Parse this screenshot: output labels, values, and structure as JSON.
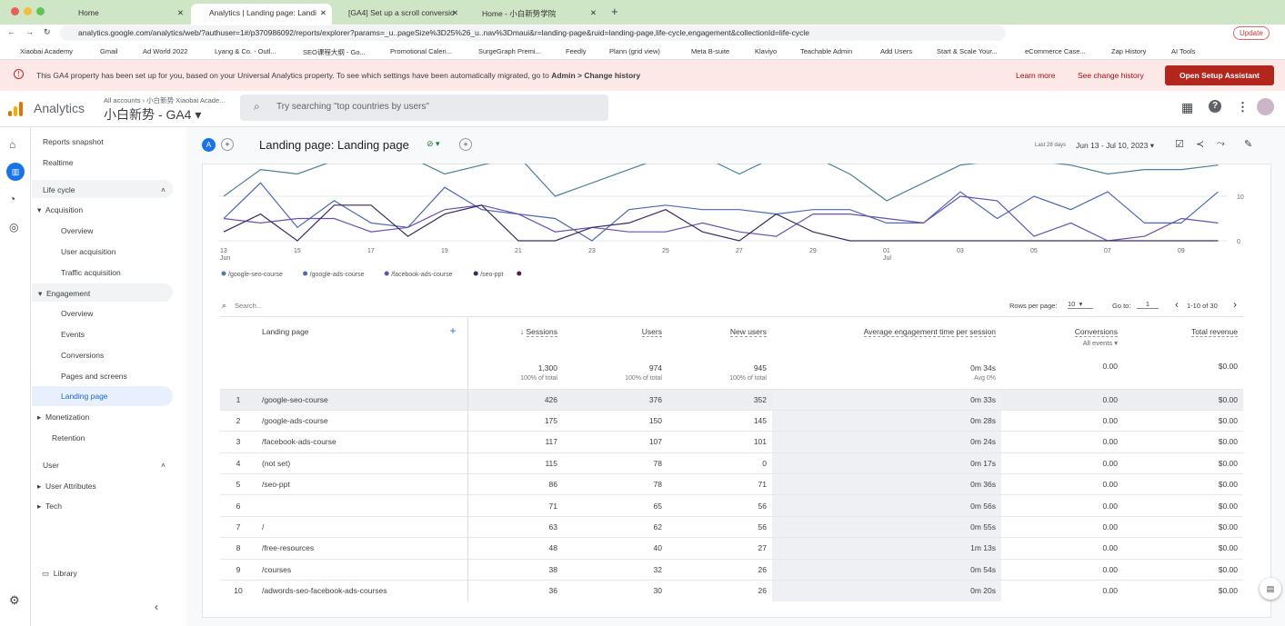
{
  "browser": {
    "tabs": [
      {
        "label": "Home"
      },
      {
        "label": "Analytics | Landing page: Landi"
      },
      {
        "label": "[GA4] Set up a scroll conversio"
      },
      {
        "label": "Home - 小白新势学院"
      }
    ],
    "url": "analytics.google.com/analytics/web/?authuser=1#/p370986092/reports/explorer?params=_u..pageSize%3D25%26_u..nav%3Dmaui&r=landing-page&ruid=landing-page,life-cycle,engagement&collectionId=life-cycle",
    "update_label": "Update",
    "bookmarks": [
      "Xiaobai Academy",
      "Gmail",
      "Ad World 2022",
      "Lyang & Co. - Outl...",
      "SEO课程大纲 - Go...",
      "Promotional Calen...",
      "SurgeGraph Premi...",
      "Feedly",
      "Plann (grid view)",
      "Meta B-suite",
      "Klaviyo",
      "Teachable Admin",
      "Add Users",
      "Start & Scale Your...",
      "eCommerce Case...",
      "Zap History",
      "AI Tools"
    ]
  },
  "banner": {
    "text": "This GA4 property has been set up for you, based on your Universal Analytics property. To see which settings have been automatically migrated, go to ",
    "bold": "Admin > Change history",
    "learn_more": "Learn more",
    "see_history": "See change history",
    "setup_button": "Open Setup Assistant"
  },
  "header": {
    "app": "Analytics",
    "breadcrumb": "All accounts › 小白新势 Xiaobai Acade...",
    "property": "小白新势 - GA4",
    "search_placeholder": "Try searching \"top countries by users\""
  },
  "sidebar": {
    "items": [
      "Reports snapshot",
      "Realtime"
    ],
    "lifecycle": "Life cycle",
    "acquisition": "Acquisition",
    "acq_items": [
      "Overview",
      "User acquisition",
      "Traffic acquisition"
    ],
    "engagement": "Engagement",
    "eng_items": [
      "Overview",
      "Events",
      "Conversions",
      "Pages and screens",
      "Landing page"
    ],
    "monetization": "Monetization",
    "retention": "Retention",
    "user": "User",
    "user_attributes": "User Attributes",
    "tech": "Tech",
    "library": "Library"
  },
  "report": {
    "avatar": "A",
    "title": "Landing page: Landing page",
    "date_label": "Last 28 days",
    "date_range": "Jun 13 - Jul 10, 2023"
  },
  "chart_data": {
    "type": "line",
    "x": [
      "13 Jun",
      "14",
      "15",
      "16",
      "17",
      "18",
      "19",
      "20",
      "21",
      "22",
      "23",
      "24",
      "25",
      "26",
      "27",
      "28",
      "29",
      "30",
      "01 Jul",
      "02",
      "03",
      "04",
      "05",
      "06",
      "07",
      "08",
      "09",
      "10"
    ],
    "xticks": [
      "13",
      "15",
      "17",
      "19",
      "21",
      "23",
      "25",
      "27",
      "29",
      "01",
      "03",
      "05",
      "07",
      "09"
    ],
    "xtick_sub": {
      "13": "Jun",
      "01": "Jul"
    },
    "yticks": [
      0,
      10
    ],
    "ylim": [
      0,
      17.5
    ],
    "series": [
      {
        "name": "/google-seo-course",
        "color": "#4a7f9b",
        "values": [
          10,
          16,
          15,
          18,
          18,
          19,
          15,
          17,
          19,
          10,
          13,
          16,
          19,
          19,
          15,
          19,
          19,
          15,
          9,
          13,
          17,
          18,
          18,
          17,
          15,
          16,
          16,
          17
        ]
      },
      {
        "name": "/google-ads-course",
        "color": "#4a68b5",
        "values": [
          5,
          13,
          3,
          9,
          4,
          3,
          12,
          7,
          6,
          5,
          0,
          7,
          8,
          7,
          7,
          6,
          7,
          7,
          4,
          4,
          11,
          5,
          10,
          7,
          11,
          4,
          4,
          11
        ]
      },
      {
        "name": "/facebook-ads-course",
        "color": "#6a4fb0",
        "values": [
          5,
          4,
          5,
          5,
          2,
          3,
          7,
          8,
          6,
          2,
          3,
          2,
          2,
          4,
          2,
          1,
          6,
          6,
          5,
          4,
          10,
          9,
          1,
          4,
          0,
          1,
          5,
          4
        ]
      },
      {
        "name": "/seo-ppt",
        "color": "#3b2a5e",
        "values": [
          2,
          6,
          0,
          8,
          8,
          1,
          6,
          8,
          0,
          0,
          3,
          4,
          7,
          2,
          0,
          6,
          2,
          0,
          0,
          0,
          0,
          0,
          0,
          0,
          0,
          0,
          0,
          0
        ]
      }
    ]
  },
  "table": {
    "search_placeholder": "Search...",
    "rows_per_page_label": "Rows per page:",
    "rows_per_page": "10",
    "goto_label": "Go to:",
    "goto": "1",
    "pager": "1-10 of 30",
    "headers": {
      "dim": "Landing page",
      "sessions": "Sessions",
      "users": "Users",
      "new_users": "New users",
      "avg": "Average engagement time per session",
      "conv": "Conversions",
      "conv_sub": "All events",
      "rev": "Total revenue"
    },
    "totals": {
      "sessions": "1,300",
      "users": "974",
      "new_users": "945",
      "avg": "0m 34s",
      "conv": "0.00",
      "rev": "$0.00",
      "pct": "100% of total",
      "avg_sub": "Avg 0%"
    },
    "rows": [
      [
        "1",
        "/google-seo-course",
        "426",
        "376",
        "352",
        "0m 33s",
        "0.00",
        "$0.00"
      ],
      [
        "2",
        "/google-ads-course",
        "175",
        "150",
        "145",
        "0m 28s",
        "0.00",
        "$0.00"
      ],
      [
        "3",
        "/facebook-ads-course",
        "117",
        "107",
        "101",
        "0m 24s",
        "0.00",
        "$0.00"
      ],
      [
        "4",
        "(not set)",
        "115",
        "78",
        "0",
        "0m 17s",
        "0.00",
        "$0.00"
      ],
      [
        "5",
        "/seo-ppt",
        "86",
        "78",
        "71",
        "0m 36s",
        "0.00",
        "$0.00"
      ],
      [
        "6",
        "",
        "71",
        "65",
        "56",
        "0m 56s",
        "0.00",
        "$0.00"
      ],
      [
        "7",
        "/",
        "63",
        "62",
        "56",
        "0m 55s",
        "0.00",
        "$0.00"
      ],
      [
        "8",
        "/free-resources",
        "48",
        "40",
        "27",
        "1m 13s",
        "0.00",
        "$0.00"
      ],
      [
        "9",
        "/courses",
        "38",
        "32",
        "26",
        "0m 54s",
        "0.00",
        "$0.00"
      ],
      [
        "10",
        "/adwords-seo-facebook-ads-courses",
        "36",
        "30",
        "26",
        "0m 20s",
        "0.00",
        "$0.00"
      ]
    ]
  }
}
